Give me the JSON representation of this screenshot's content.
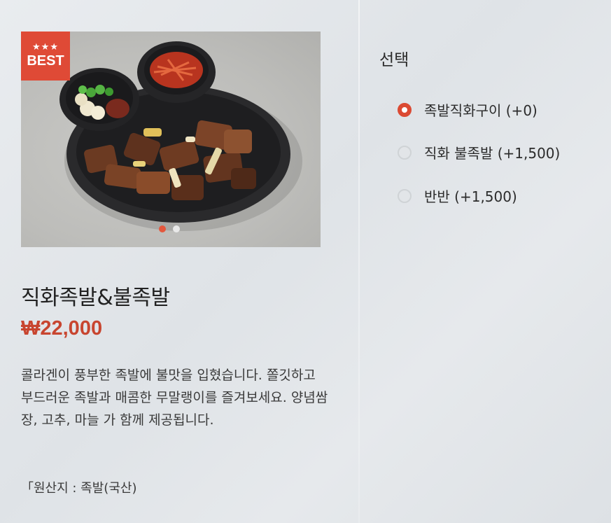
{
  "product": {
    "badge": {
      "stars": "★★★",
      "label": "BEST"
    },
    "gallery": {
      "image_icon": "food-photo",
      "slide_count": 2,
      "active_slide": 1
    },
    "title": "직화족발&불족발",
    "price": "₩22,000",
    "description": "콜라겐이 풍부한 족발에 불맛을 입혔습니다. 쫄깃하고 부드러운 족발과 매콤한 무말랭이를 즐겨보세요. 양념쌈장, 고추, 마늘 가 함께 제공됩니다.",
    "origin": "「원산지 : 족발(국산)"
  },
  "options": {
    "title": "선택",
    "items": [
      {
        "label": "족발직화구이 (+0)",
        "selected": true
      },
      {
        "label": "직화 불족발 (+1,500)",
        "selected": false
      },
      {
        "label": "반반 (+1,500)",
        "selected": false
      }
    ]
  },
  "colors": {
    "accent": "#df4a36",
    "price": "#c8452f"
  }
}
